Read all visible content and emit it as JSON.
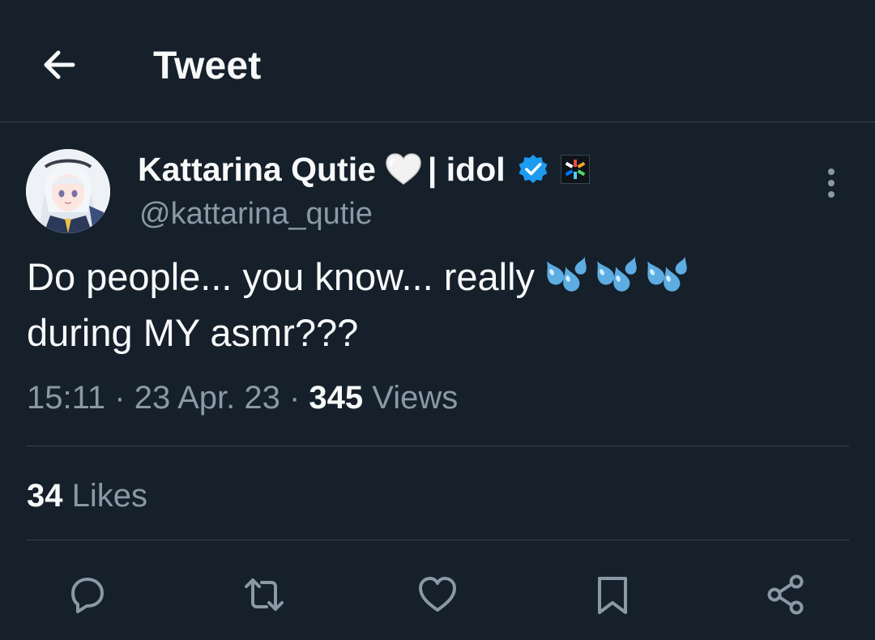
{
  "header": {
    "title": "Tweet",
    "back_icon": "arrow-left-icon"
  },
  "tweet": {
    "author": {
      "display_name": "Kattarina Qutie",
      "name_suffix": "| idol",
      "handle": "@kattarina_qutie",
      "avatar_icon": "avatar-anime-girl",
      "name_emoji": "white-heart",
      "verified": true,
      "verified_color": "#1d9bf0",
      "affiliate_badge_icon": "affiliate-logo-icon"
    },
    "text_line_1": "Do people... you know... really",
    "text_emoji": "sweat-droplets x3",
    "text_line_2": "during MY asmr???",
    "time": "15:11",
    "date": "23 Apr. 23",
    "views_count": "345",
    "views_label": "Views",
    "likes_count": "34",
    "likes_label": "Likes"
  },
  "actions": {
    "reply": "reply-icon",
    "retweet": "retweet-icon",
    "like": "like-heart-icon",
    "bookmark": "bookmark-icon",
    "share": "share-icon"
  },
  "colors": {
    "background": "#15202b",
    "text_primary": "#f7f9f9",
    "text_secondary": "#8b98a5",
    "divider": "#38444d",
    "accent": "#1d9bf0"
  }
}
